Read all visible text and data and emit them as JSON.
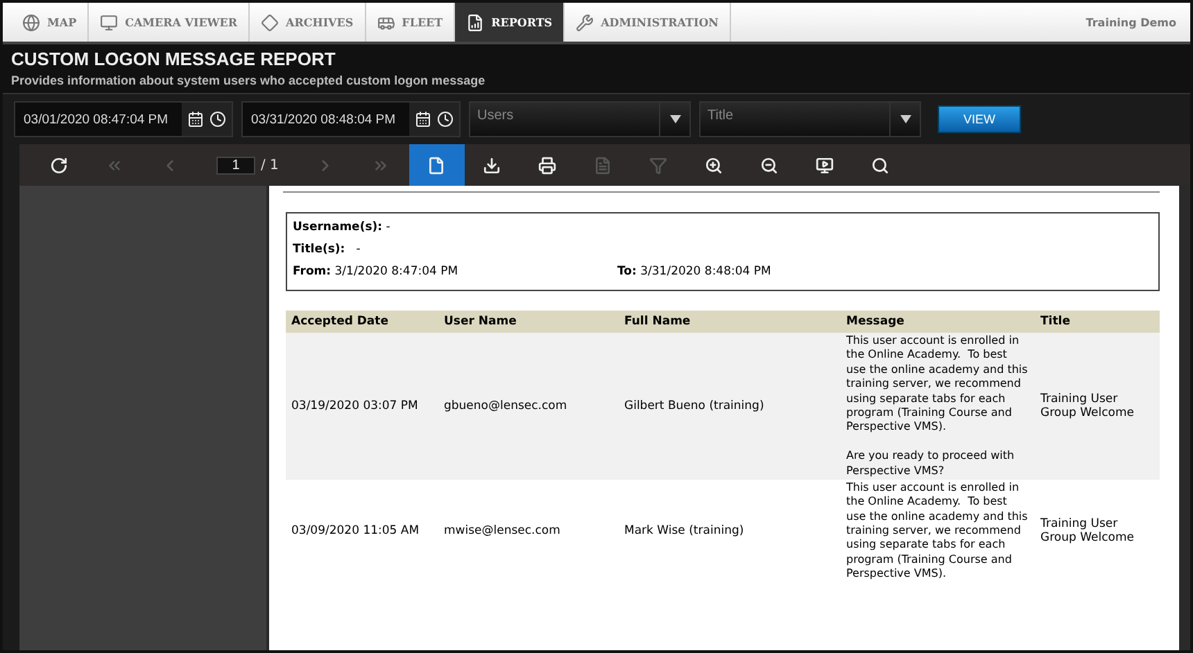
{
  "nav": {
    "tabs": [
      {
        "label": "MAP",
        "selected": false
      },
      {
        "label": "CAMERA VIEWER",
        "selected": false
      },
      {
        "label": "ARCHIVES",
        "selected": false
      },
      {
        "label": "FLEET",
        "selected": false
      },
      {
        "label": "REPORTS",
        "selected": true
      },
      {
        "label": "ADMINISTRATION",
        "selected": false
      }
    ],
    "account": "Training Demo"
  },
  "header": {
    "title": "CUSTOM LOGON MESSAGE REPORT",
    "subtitle": "Provides information about system users who accepted custom logon message"
  },
  "filters": {
    "from": "03/01/2020 08:47:04 PM",
    "to": "03/31/2020 08:48:04 PM",
    "users_placeholder": "Users",
    "title_placeholder": "Title",
    "view_button": "VIEW"
  },
  "toolbar": {
    "page": "1",
    "page_total": "/ 1",
    "tools": [
      {
        "kind": "refresh",
        "disabled": false,
        "selected": false
      },
      {
        "kind": "first",
        "disabled": true,
        "selected": false
      },
      {
        "kind": "prev",
        "disabled": true,
        "selected": false
      },
      {
        "kind": "next",
        "disabled": true,
        "selected": false
      },
      {
        "kind": "last",
        "disabled": true,
        "selected": false
      },
      {
        "kind": "page",
        "disabled": false,
        "selected": true
      },
      {
        "kind": "download",
        "disabled": false,
        "selected": false
      },
      {
        "kind": "print",
        "disabled": false,
        "selected": false
      },
      {
        "kind": "doc",
        "disabled": true,
        "selected": false
      },
      {
        "kind": "filter",
        "disabled": true,
        "selected": false
      },
      {
        "kind": "zoomin",
        "disabled": false,
        "selected": false
      },
      {
        "kind": "zoomout",
        "disabled": false,
        "selected": false
      },
      {
        "kind": "monitor",
        "disabled": false,
        "selected": false
      },
      {
        "kind": "search",
        "disabled": false,
        "selected": false
      }
    ]
  },
  "report": {
    "criteria": {
      "usernames_label": "Username(s):",
      "usernames": "-",
      "titles_label": "Title(s):",
      "titles": "-",
      "from_label": "From:",
      "from": "3/1/2020 8:47:04 PM",
      "to_label": "To:",
      "to": "3/31/2020 8:48:04 PM"
    },
    "table": {
      "columns": [
        "Accepted Date",
        "User Name",
        "Full Name",
        "Message",
        "Title"
      ],
      "rows": [
        [
          "03/19/2020 03:07 PM",
          "gbueno@lensec.com",
          "Gilbert Bueno (training)",
          "This user account is enrolled in the Online Academy.  To best use the online academy and this training server, we recommend using separate tabs for each program (Training Course and Perspective VMS).\n\nAre you ready to proceed with Perspective VMS?",
          "Training User Group Welcome"
        ],
        [
          "03/09/2020 11:05 AM",
          "mwise@lensec.com",
          "Mark Wise (training)",
          "This user account is enrolled in the Online Academy.  To best use the online academy and this training server, we recommend using separate tabs for each program (Training Course and Perspective VMS).",
          "Training User Group Welcome"
        ]
      ]
    }
  }
}
